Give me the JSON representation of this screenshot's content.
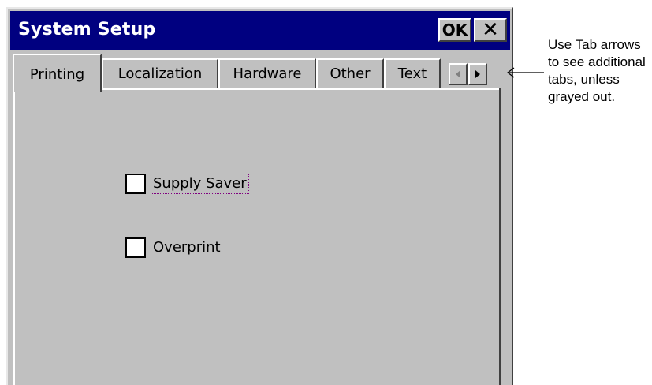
{
  "window": {
    "title": "System Setup",
    "ok_label": "OK",
    "close_label": "✕"
  },
  "tabs": [
    {
      "label": "Printing",
      "active": true
    },
    {
      "label": "Localization",
      "active": false
    },
    {
      "label": "Hardware",
      "active": false
    },
    {
      "label": "Other",
      "active": false
    },
    {
      "label": "Text",
      "active": false
    }
  ],
  "tab_scroll": {
    "left_icon": "arrow-left-icon",
    "right_icon": "arrow-right-icon",
    "left_state": "grayed"
  },
  "options": [
    {
      "label": "Supply Saver",
      "checked": false,
      "focused": true
    },
    {
      "label": "Overprint",
      "checked": false,
      "focused": false
    }
  ],
  "annotation": {
    "text": "Use Tab arrows to see additional tabs, unless grayed out."
  },
  "colors": {
    "titlebar": "#000080",
    "face": "#c0c0c0",
    "focus_outline": "#800080"
  }
}
